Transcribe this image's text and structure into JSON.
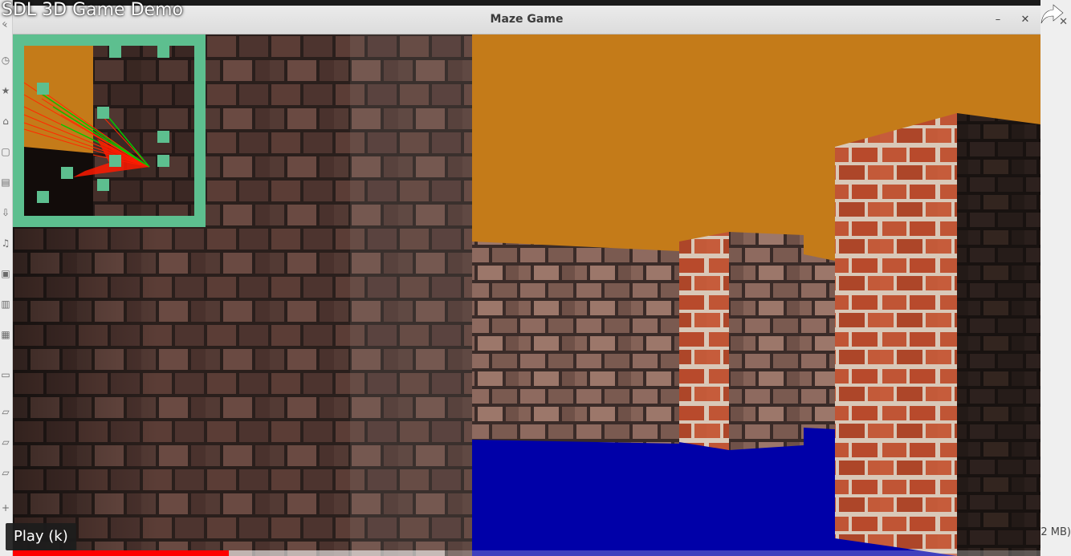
{
  "video": {
    "title": "SDL 3D Game Demo",
    "tooltip": "Play (k)",
    "progress": 0.21,
    "hover_progress": 0.42,
    "share_icon": "share-arrow-icon"
  },
  "window": {
    "title": "Maze Game",
    "minimize_icon": "minimize-icon",
    "close_icon": "close-icon"
  },
  "background": {
    "size_label": "2 MB)",
    "sidebar_icons": [
      "clock-icon",
      "star-icon",
      "home-icon",
      "folder-icon",
      "document-icon",
      "download-icon",
      "music-icon",
      "image-icon",
      "video-icon",
      "trash-icon",
      "drive-icon",
      "folder-icon",
      "folder-icon",
      "folder-icon",
      "add-icon"
    ]
  },
  "game": {
    "colors": {
      "sky": "#c47b19",
      "floor": "#0000a8",
      "brick_dark": "#3d2a25",
      "brick_red": "#c05535",
      "minimap_border": "#5dbf8f",
      "minimap_block": "#5dbf8f",
      "ray_red": "#ff0000",
      "ray_green": "#00cc00"
    }
  }
}
